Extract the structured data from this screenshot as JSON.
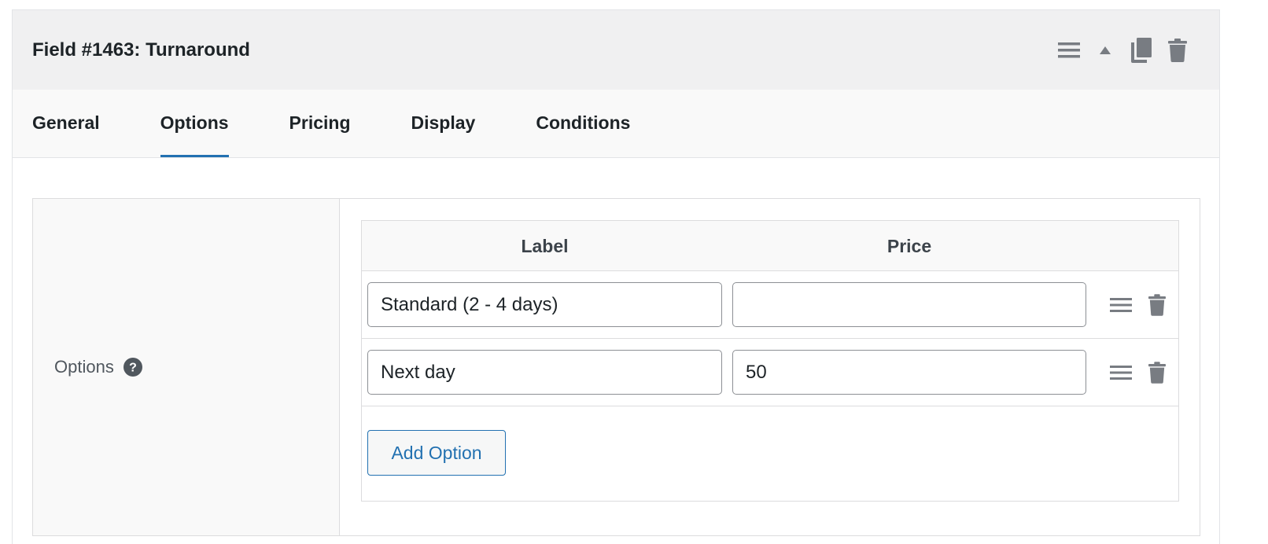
{
  "header": {
    "title": "Field #1463: Turnaround",
    "actions": [
      "menu-icon",
      "arrow-up-icon",
      "duplicate-icon",
      "trash-icon"
    ]
  },
  "tabs": [
    {
      "label": "General",
      "active": false
    },
    {
      "label": "Options",
      "active": true
    },
    {
      "label": "Pricing",
      "active": false
    },
    {
      "label": "Display",
      "active": false
    },
    {
      "label": "Conditions",
      "active": false
    }
  ],
  "options_field": {
    "label": "Options",
    "help_icon": "question-circle-icon",
    "columns": {
      "label": "Label",
      "price": "Price"
    },
    "rows": [
      {
        "label": "Standard (2 - 4 days)",
        "price": ""
      },
      {
        "label": "Next day",
        "price": "50"
      }
    ],
    "add_button_label": "Add Option"
  },
  "colors": {
    "accent": "#2271b1",
    "header_bg": "#f0f0f1",
    "icon": "#787c82"
  }
}
